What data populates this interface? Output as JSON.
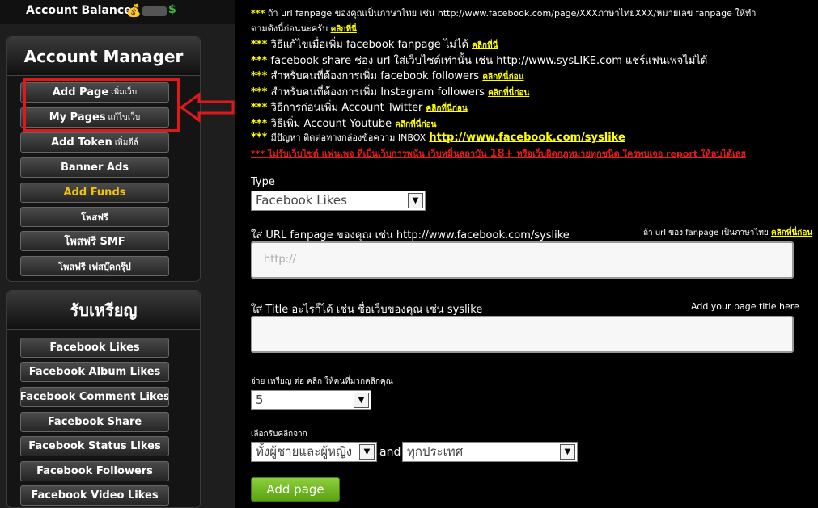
{
  "balance": {
    "label": "Account Balance:",
    "currency": "$"
  },
  "account_manager": {
    "title": "Account Manager",
    "items": [
      {
        "label": "Add Page",
        "sub": "เพิ่มเว็บ"
      },
      {
        "label": "My Pages",
        "sub": "แก้ไขเว็บ"
      },
      {
        "label": "Add Token",
        "sub": "เพิ่มดีล์"
      },
      {
        "label": "Banner Ads",
        "sub": ""
      },
      {
        "label": "Add Funds",
        "sub": ""
      },
      {
        "label": "โพสฟรี",
        "sub": ""
      },
      {
        "label": "โพสฟรี SMF",
        "sub": ""
      },
      {
        "label": "โพสฟรี เฟสบุ๊คกรุ๊ป",
        "sub": ""
      }
    ]
  },
  "earn": {
    "title": "รับเหรียญ",
    "items": [
      "Facebook Likes",
      "Facebook Album Likes",
      "Facebook Comment Likes",
      "Facebook Share",
      "Facebook Status Likes",
      "Facebook Followers",
      "Facebook Video Likes"
    ]
  },
  "notes": [
    {
      "text": "ถ้า url fanpage ของคุณเป็นภาษาไทย เช่น http://www.facebook.com/page/XXXภาษาไทยXXX/หมายเลข fanpage ให้ทำ",
      "link": ""
    },
    {
      "text": "ตามดังนี้ก่อนนะครับ",
      "link": "คลิกที่นี่"
    },
    {
      "text": "วิธีแก้ไขเมื่อเพิ่ม facebook fanpage ไม่ได้",
      "link": "คลิกที่นี่"
    },
    {
      "text": "facebook share ช่อง url ใส่เว็บไซต์เท่านั้น เช่น http://www.sysLIKE.com แชร์แฟนเพจไม่ได้",
      "link": ""
    },
    {
      "text": "สำหรับคนที่ต้องการเพิ่ม facebook followers",
      "link": "คลิกที่นี่ก่อน"
    },
    {
      "text": "สำหรับคนที่ต้องการเพิ่ม Instagram followers",
      "link": "คลิกที่นี่ก่อน"
    },
    {
      "text": "วิธีการก่อนเพิ่ม Account Twitter",
      "link": "คลิกที่นี่ก่อน"
    },
    {
      "text": "วิธีเพิ่ม Account Youtube",
      "link": "คลิกที่นี่ก่อน"
    },
    {
      "text": "มีปัญหา ติดต่อทางกล่องข้อความ INBOX",
      "link": "http://www.facebook.com/syslike"
    },
    {
      "text": "ไม่รับเว็บไซต์ แฟนเพจ ที่เป็นเว็บการพนัน เว็บหมิ่นสถาบัน",
      "highlight": "18+",
      "tail": "หรือเว็บผิดกฎหมายทุกชนิด ใครพบเจอ report ให้ลบได้เลย"
    }
  ],
  "star": "***",
  "form": {
    "type_label": "Type",
    "type_value": "Facebook Likes",
    "url_label": "ใส่ URL fanpage ของคุณ เช่น http://www.facebook.com/syslike",
    "url_hint": "ถ้า url ของ fanpage เป็นภาษาไทย",
    "url_hint_link": "คลิกที่นี่ก่อน",
    "url_placeholder": "http://",
    "title_label": "ใส่ Title อะไรก็ได้ เช่น ชื่อเว็บของคุณ เช่น syslike",
    "title_hint": "Add your page title here",
    "cpc_label": "จ่าย เหรียญ ต่อ คลิก ให้คนที่มากคลิกคุณ",
    "cpc_value": "5",
    "target_label": "เลือกรับคลิกจาก",
    "gender_value": "ทั้งผู้ชายและผู้หญิง",
    "and_label": "and",
    "country_value": "ทุกประเทศ",
    "submit_label": "Add page"
  },
  "colors": {
    "accent_yellow": "#ffff00",
    "warning_red": "#e01c1c",
    "submit_green": "#6bb521",
    "highlight_box": "#e0181c"
  }
}
